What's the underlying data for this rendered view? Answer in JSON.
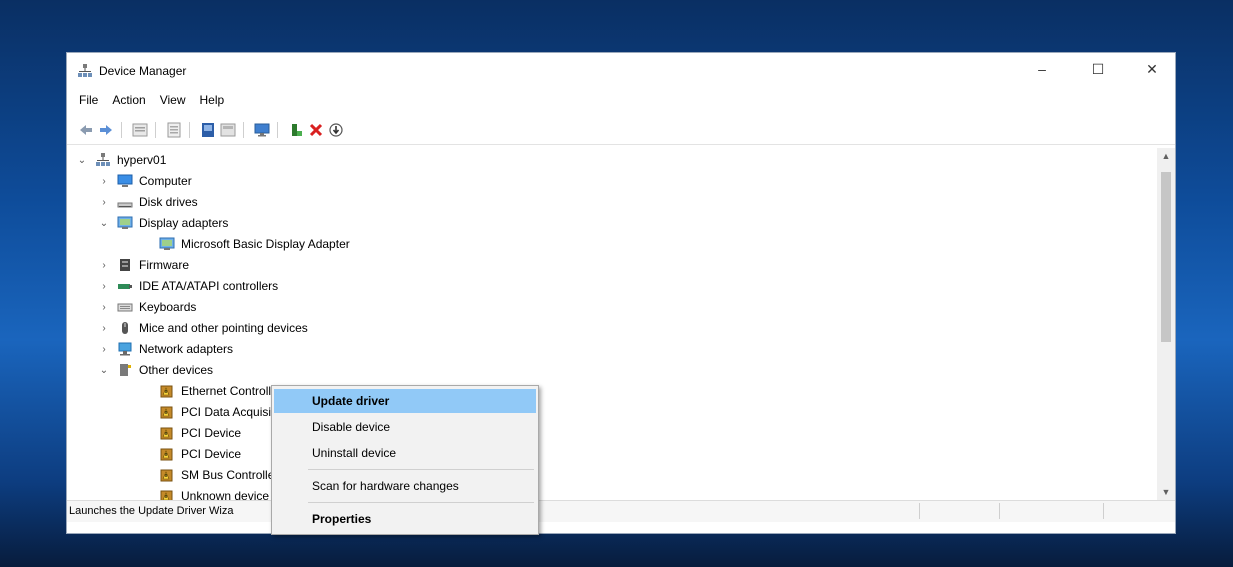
{
  "window": {
    "title": "Device Manager"
  },
  "titlebar_buttons": {
    "minimize": "–",
    "maximize": "☐",
    "close": "✕"
  },
  "menu": [
    "File",
    "Action",
    "View",
    "Help"
  ],
  "toolbar_icons": [
    "back-icon",
    "forward-icon",
    "properties-icon",
    "details-icon",
    "help-icon",
    "show-hidden-icon",
    "monitor-icon",
    "update-driver-icon",
    "uninstall-icon",
    "scan-icon"
  ],
  "tree": {
    "root": "hyperv01",
    "items": [
      {
        "label": "Computer",
        "expander": "›",
        "icon": "computer-icon"
      },
      {
        "label": "Disk drives",
        "expander": "›",
        "icon": "disk-drive-icon"
      },
      {
        "label": "Display adapters",
        "expander": "⌄",
        "icon": "display-adapter-icon"
      },
      {
        "label": "Microsoft Basic Display Adapter",
        "expander": "",
        "icon": "display-adapter-icon"
      },
      {
        "label": "Firmware",
        "expander": "›",
        "icon": "firmware-icon"
      },
      {
        "label": "IDE ATA/ATAPI controllers",
        "expander": "›",
        "icon": "ide-controller-icon"
      },
      {
        "label": "Keyboards",
        "expander": "›",
        "icon": "keyboard-icon"
      },
      {
        "label": "Mice and other pointing devices",
        "expander": "›",
        "icon": "mouse-icon"
      },
      {
        "label": "Network adapters",
        "expander": "›",
        "icon": "network-adapter-icon"
      },
      {
        "label": "Other devices",
        "expander": "⌄",
        "icon": "other-devices-icon"
      },
      {
        "label": "Ethernet Controlle",
        "expander": "",
        "icon": "unknown-device-icon"
      },
      {
        "label": "PCI Data Acquisiti",
        "expander": "",
        "icon": "unknown-device-icon"
      },
      {
        "label": "PCI Device",
        "expander": "",
        "icon": "unknown-device-icon"
      },
      {
        "label": "PCI Device",
        "expander": "",
        "icon": "unknown-device-icon"
      },
      {
        "label": "SM Bus Controlle",
        "expander": "",
        "icon": "unknown-device-icon"
      },
      {
        "label": "Unknown device",
        "expander": "",
        "icon": "unknown-device-icon"
      }
    ]
  },
  "context_menu": {
    "update": "Update driver",
    "disable": "Disable device",
    "uninstall": "Uninstall device",
    "scan": "Scan for hardware changes",
    "properties": "Properties"
  },
  "status": {
    "text": "Launches the Update Driver Wiza"
  },
  "colors": {
    "highlight": "#91c9f7",
    "accent": "#0e4c9a"
  }
}
